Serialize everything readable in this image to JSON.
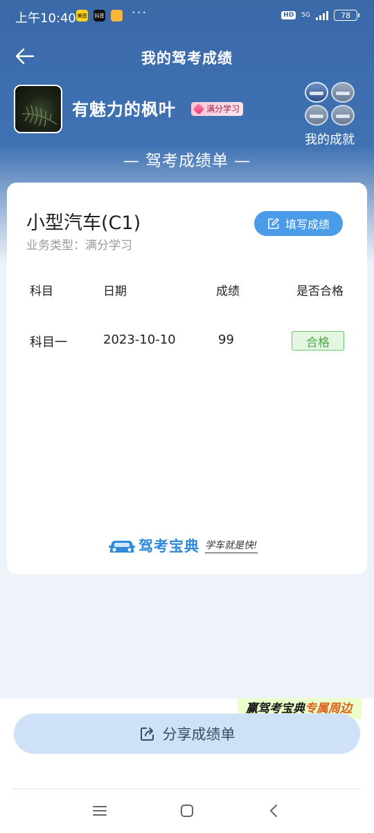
{
  "status_bar": {
    "time": "上午10:40",
    "app_icons": [
      "美团",
      "抖音",
      "消息"
    ],
    "more": "···",
    "hd": "HD",
    "network": "5G",
    "battery": "78"
  },
  "nav": {
    "title": "我的驾考成绩"
  },
  "profile": {
    "username": "有魅力的枫叶",
    "badge": "满分学习",
    "achievements_label": "我的成就"
  },
  "report_title": "— 驾考成绩单 —",
  "card": {
    "license_type": "小型汽车(C1)",
    "business_type": "业务类型：满分学习",
    "fill_button_label": "填写成绩",
    "table": {
      "headers": [
        "科目",
        "日期",
        "成绩",
        "是否合格"
      ],
      "rows": [
        {
          "subject": "科目一",
          "date": "2023-10-10",
          "score": "99",
          "passed": "合格"
        }
      ]
    },
    "brand": {
      "name": "驾考宝典",
      "slogan": "学车就是快!"
    }
  },
  "promo": {
    "prefix": "赢驾考宝典",
    "highlight": "专属周边"
  },
  "share_button_label": "分享成绩单",
  "colors": {
    "header_blue": "#3a69a8",
    "button_blue": "#4a9be8",
    "pass_green": "#4aa946",
    "brand_blue": "#2e8ad8"
  }
}
